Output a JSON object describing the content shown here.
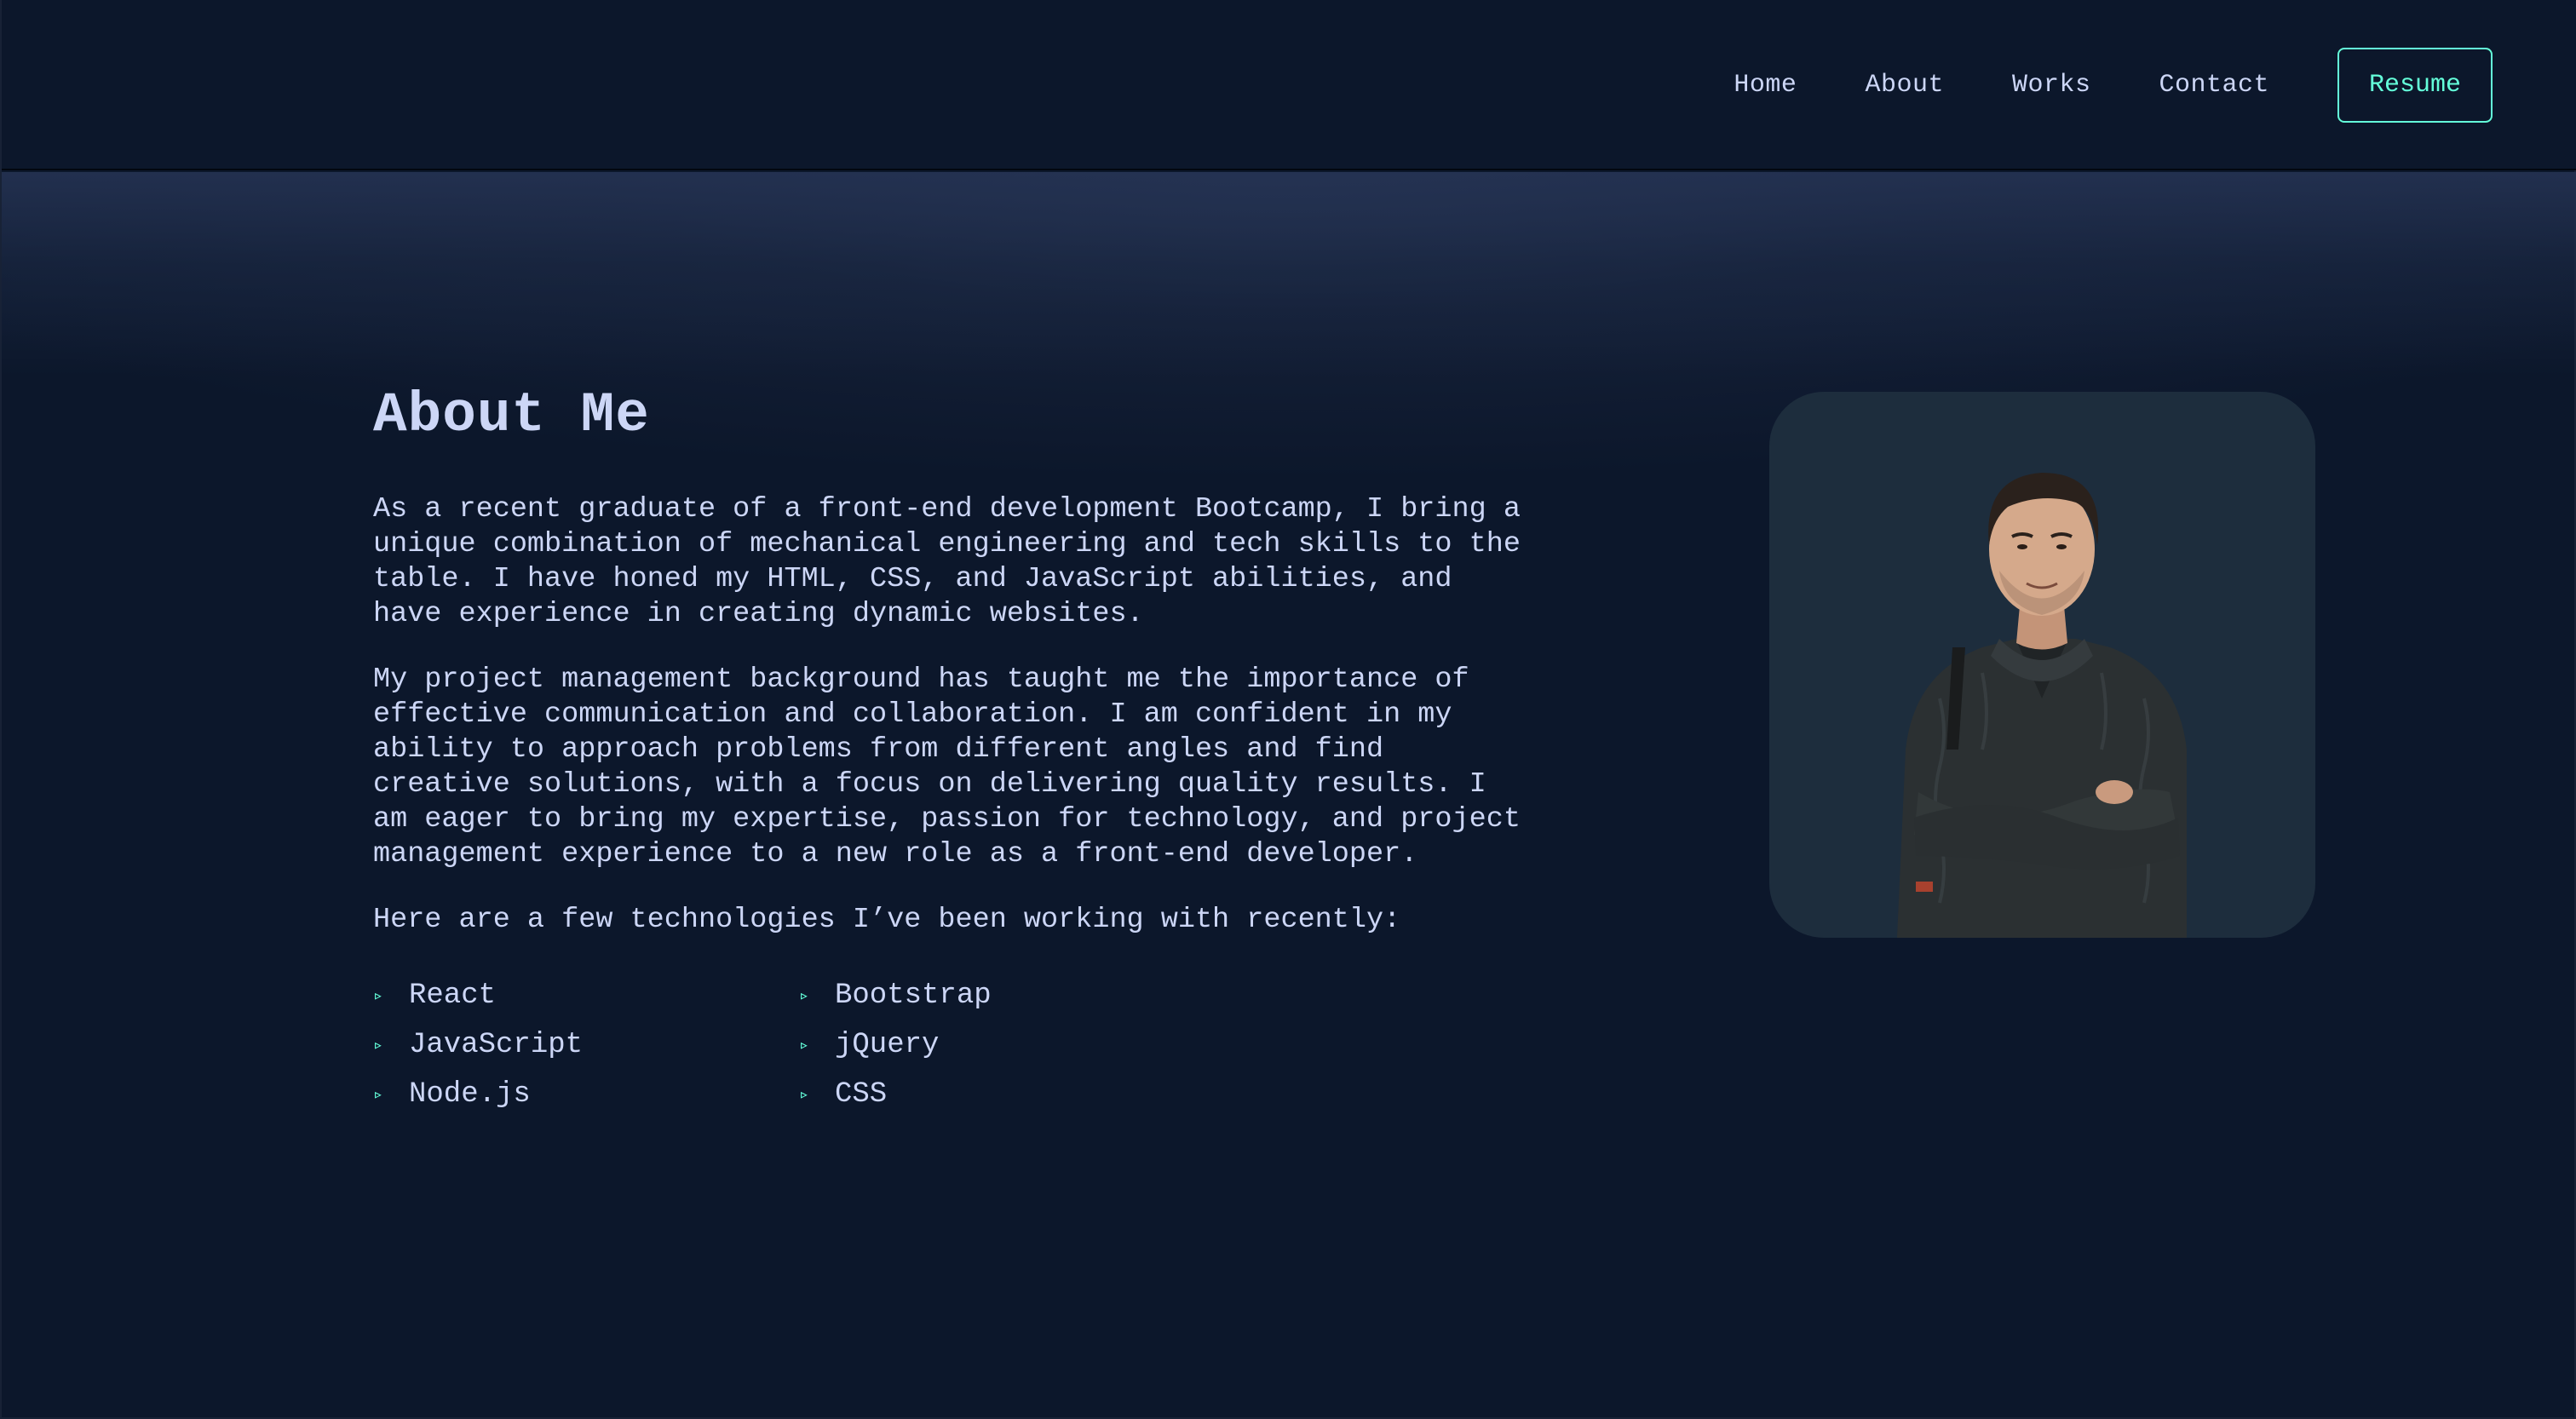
{
  "nav": {
    "links": [
      "Home",
      "About",
      "Works",
      "Contact"
    ],
    "resume_label": "Resume"
  },
  "about": {
    "title": "About Me",
    "paragraphs": [
      "As a recent graduate of a front-end development Bootcamp, I bring a\nunique combination of mechanical engineering and tech skills to the\ntable. I have honed my HTML, CSS, and JavaScript abilities, and\nhave experience in creating dynamic websites.",
      "My project management background has taught me the importance of\neffective communication and collaboration. I am confident in my\nability to approach problems from different angles and find\ncreative solutions, with a focus on delivering quality results. I\nam eager to bring my expertise, passion for technology, and project\nmanagement experience to a new role as a front-end developer.",
      "Here are a few technologies I’ve been working with recently:"
    ],
    "technologies": [
      "React",
      "JavaScript",
      "Node.js",
      "Bootstrap",
      "jQuery",
      "CSS"
    ],
    "bullet_glyph": "▹"
  },
  "colors": {
    "background": "#0c172b",
    "text": "#ccd6f6",
    "accent": "#64ffda",
    "portrait_bg": "#1d2d3d"
  },
  "portrait": {
    "icon": "person-photo"
  }
}
